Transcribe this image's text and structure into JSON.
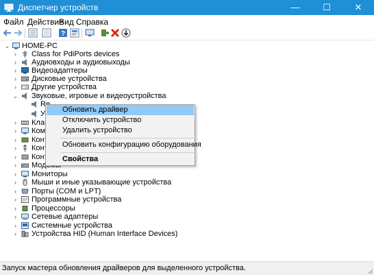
{
  "window": {
    "title": "Диспетчер устройств",
    "minimize": "—",
    "maximize": "☐",
    "close": "✕"
  },
  "menu": [
    "Файл",
    "Действие",
    "Вид",
    "Справка"
  ],
  "toolbar": [
    "back-icon",
    "forward-icon",
    "properties-icon",
    "list-view-icon",
    "help-icon",
    "show-hidden-icon",
    "monitor-icon",
    "update-driver-icon",
    "uninstall-icon",
    "download-icon"
  ],
  "tree": {
    "root": "HOME-PC",
    "items": [
      "Class for PdiPorts devices",
      "Аудиовходы и аудиовыходы",
      "Видеоадаптеры",
      "Дисковые устройства",
      "Другие устройства",
      "Звуковые, игровые и видеоустройства",
      "Re",
      "Ус",
      "Клав",
      "Комп",
      "Конт",
      "Конт",
      "Конт",
      "Модемы",
      "Мониторы",
      "Мыши и иные указывающие устройства",
      "Порты (COM и LPT)",
      "Программные устройства",
      "Процессоры",
      "Сетевые адаптеры",
      "Системные устройства",
      "Устройства HID (Human Interface Devices)"
    ]
  },
  "context_menu": {
    "update": "Обновить драйвер",
    "disable": "Отключить устройство",
    "uninstall": "Удалить устройство",
    "scan": "Обновить конфигурацию оборудования",
    "properties": "Свойства"
  },
  "status": "Запуск мастера обновления драйверов для выделенного устройства.",
  "colors": {
    "titlebar": "#1f8fd6",
    "highlight": "#91c9f7"
  }
}
